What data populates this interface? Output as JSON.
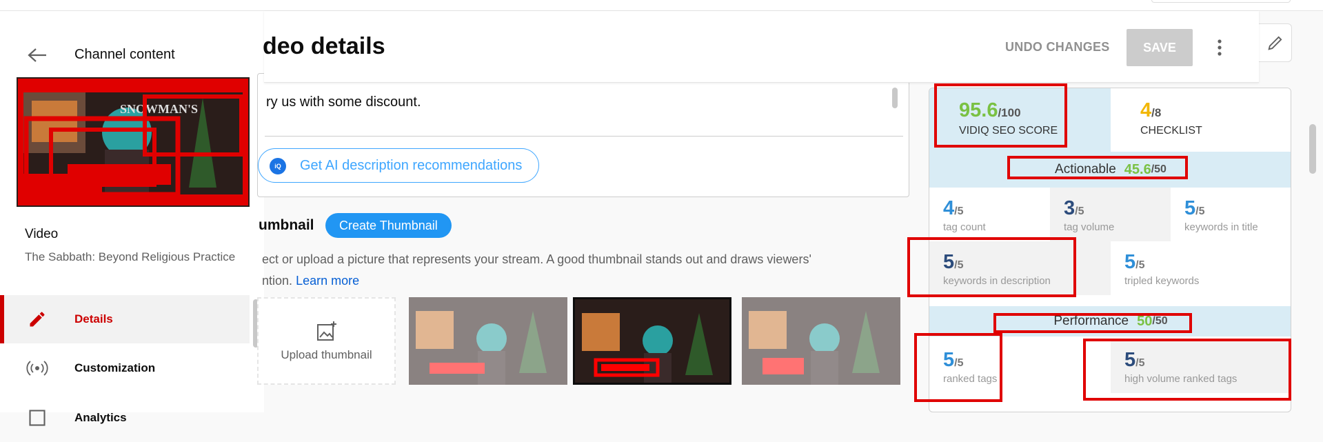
{
  "sidebar": {
    "title": "Channel content",
    "video_label": "Video",
    "video_name": "The Sabbath: Beyond Religious Practice",
    "nav": [
      {
        "label": "Details",
        "icon": "pencil-icon"
      },
      {
        "label": "Customization",
        "icon": "broadcast-icon"
      },
      {
        "label": "Analytics",
        "icon": "analytics-icon"
      }
    ]
  },
  "header": {
    "title": "deo details",
    "undo_label": "UNDO CHANGES",
    "save_label": "SAVE"
  },
  "description": {
    "text": "ry us with some discount.",
    "ai_button": "Get AI description recommendations",
    "ai_icon_text": "iQ"
  },
  "thumbnail": {
    "heading": "umbnail",
    "create_button": "Create Thumbnail",
    "help_line1": "ect or upload a picture that represents your stream. A good thumbnail stands out and draws viewers'",
    "help_line2_prefix": "ntion.",
    "learn_more": "Learn more",
    "upload_label": "Upload thumbnail"
  },
  "seo": {
    "score": {
      "value": "95.6",
      "max": "/100",
      "label": "VIDIQ SEO SCORE"
    },
    "checklist": {
      "value": "4",
      "max": "/8",
      "label": "CHECKLIST"
    },
    "actionable": {
      "label": "Actionable",
      "value": "45.6",
      "max": "/50"
    },
    "actionable_metrics": [
      {
        "value": "4",
        "max": "/5",
        "label": "tag count"
      },
      {
        "value": "3",
        "max": "/5",
        "label": "tag volume"
      },
      {
        "value": "5",
        "max": "/5",
        "label": "keywords in title"
      },
      {
        "value": "5",
        "max": "/5",
        "label": "keywords in description"
      },
      {
        "value": "5",
        "max": "/5",
        "label": "tripled keywords"
      }
    ],
    "performance": {
      "label": "Performance",
      "value": "50",
      "max": "/50"
    },
    "performance_metrics": [
      {
        "value": "5",
        "max": "/5",
        "label": "ranked tags"
      },
      {
        "value": "5",
        "max": "/5",
        "label": "high volume ranked tags"
      }
    ]
  },
  "colors": {
    "score_green": "#7ac143",
    "checklist_yellow": "#f2b705",
    "metric_blue": "#2f8fd8",
    "metric_navy": "#2c4c7c",
    "accent_red": "#cc0000",
    "link_blue": "#065fd4",
    "panel_blue": "#d9ecf5",
    "annotation_red": "#e00000"
  }
}
